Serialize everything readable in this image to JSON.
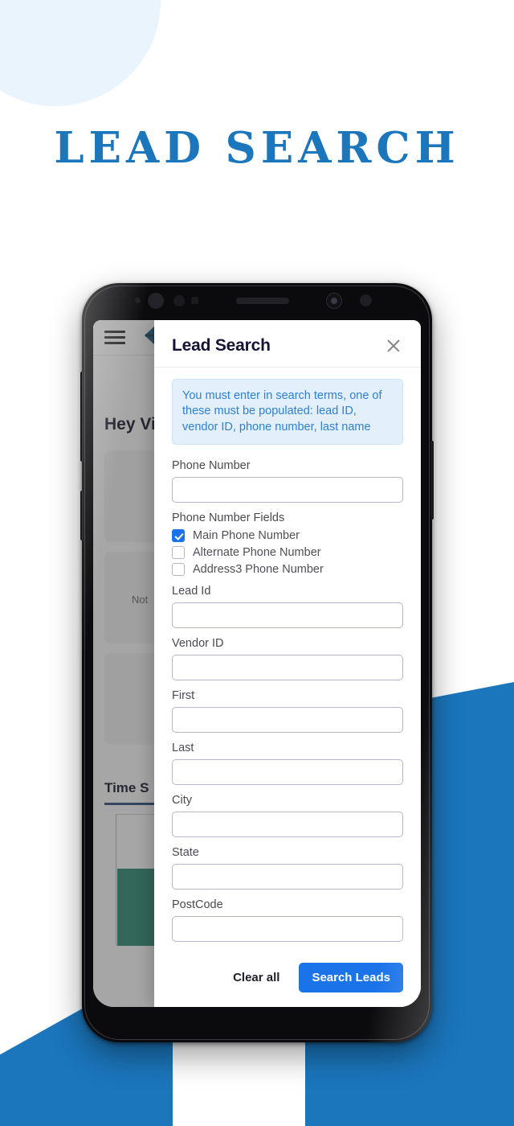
{
  "page": {
    "title": "LEAD SEARCH",
    "accent_blue": "#1b76bc",
    "circle_color": "#e9f4fd"
  },
  "background_app": {
    "menu_icon": "hamburger-icon",
    "logo_icon": "company-diamond-logo-icon",
    "greeting": "Hey Vin",
    "note_text": "Not",
    "tab_label": "Time S",
    "chart_bar_color": "#2a8a72"
  },
  "modal": {
    "title": "Lead Search",
    "close_icon": "close-icon",
    "alert": "You must enter in search terms, one of these must be populated: lead ID, vendor ID, phone number, last name",
    "phone_number": {
      "label": "Phone Number",
      "value": "",
      "placeholder": ""
    },
    "checkbox_group": {
      "label": "Phone Number Fields",
      "items": [
        {
          "label": "Main Phone Number",
          "checked": true
        },
        {
          "label": "Alternate Phone Number",
          "checked": false
        },
        {
          "label": "Address3 Phone Number",
          "checked": false
        }
      ]
    },
    "fields": [
      {
        "label": "Lead Id",
        "value": "",
        "placeholder": ""
      },
      {
        "label": "Vendor ID",
        "value": "",
        "placeholder": ""
      },
      {
        "label": "First",
        "value": "",
        "placeholder": ""
      },
      {
        "label": "Last",
        "value": "",
        "placeholder": ""
      },
      {
        "label": "City",
        "value": "",
        "placeholder": ""
      },
      {
        "label": "State",
        "value": "",
        "placeholder": ""
      },
      {
        "label": "PostCode",
        "value": "",
        "placeholder": ""
      }
    ],
    "footer": {
      "clear_label": "Clear all",
      "search_label": "Search Leads",
      "search_button_color": "#1a73e8"
    }
  }
}
